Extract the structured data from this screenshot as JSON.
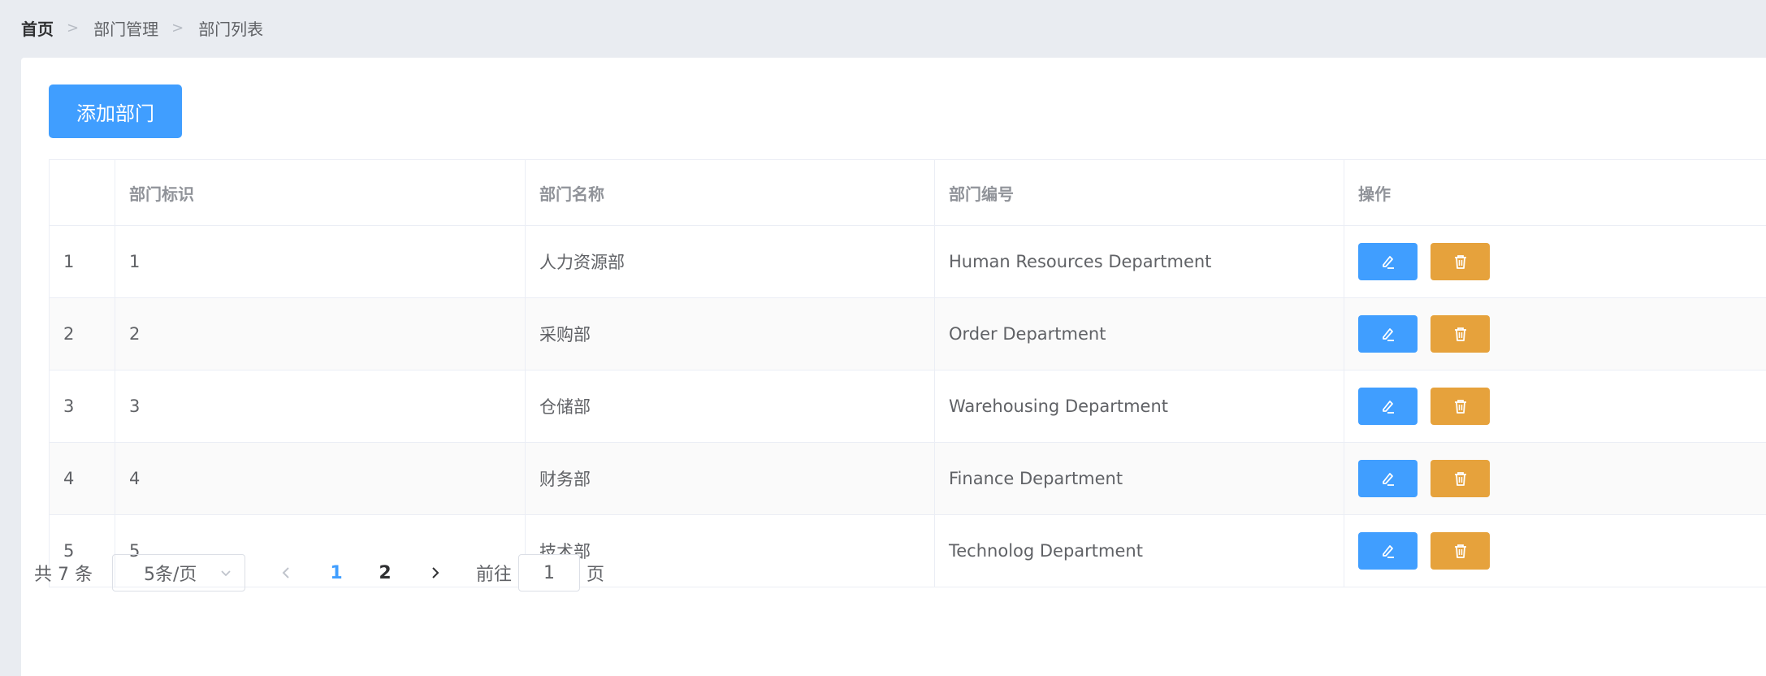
{
  "breadcrumb": {
    "items": [
      "首页",
      "部门管理",
      "部门列表"
    ]
  },
  "toolbar": {
    "add_label": "添加部门"
  },
  "table": {
    "columns": [
      "",
      "部门标识",
      "部门名称",
      "部门编号",
      "操作"
    ],
    "rows": [
      {
        "index": "1",
        "id": "1",
        "name": "人力资源部",
        "code": "Human Resources Department"
      },
      {
        "index": "2",
        "id": "2",
        "name": "采购部",
        "code": "Order Department"
      },
      {
        "index": "3",
        "id": "3",
        "name": "仓储部",
        "code": "Warehousing Department"
      },
      {
        "index": "4",
        "id": "4",
        "name": "财务部",
        "code": "Finance Department"
      },
      {
        "index": "5",
        "id": "5",
        "name": "技术部",
        "code": "Technolog Department"
      }
    ],
    "actions": {
      "edit_icon": "edit-icon",
      "delete_icon": "delete-icon"
    }
  },
  "pagination": {
    "total": "共 7 条",
    "page_size": "5条/页",
    "pages": [
      "1",
      "2"
    ],
    "current_page": "1",
    "goto_label": "前往",
    "goto_value": "1",
    "page_suffix": "页"
  },
  "colors": {
    "primary": "#409eff",
    "warning": "#e6a23c",
    "background": "#e9ecf1"
  }
}
